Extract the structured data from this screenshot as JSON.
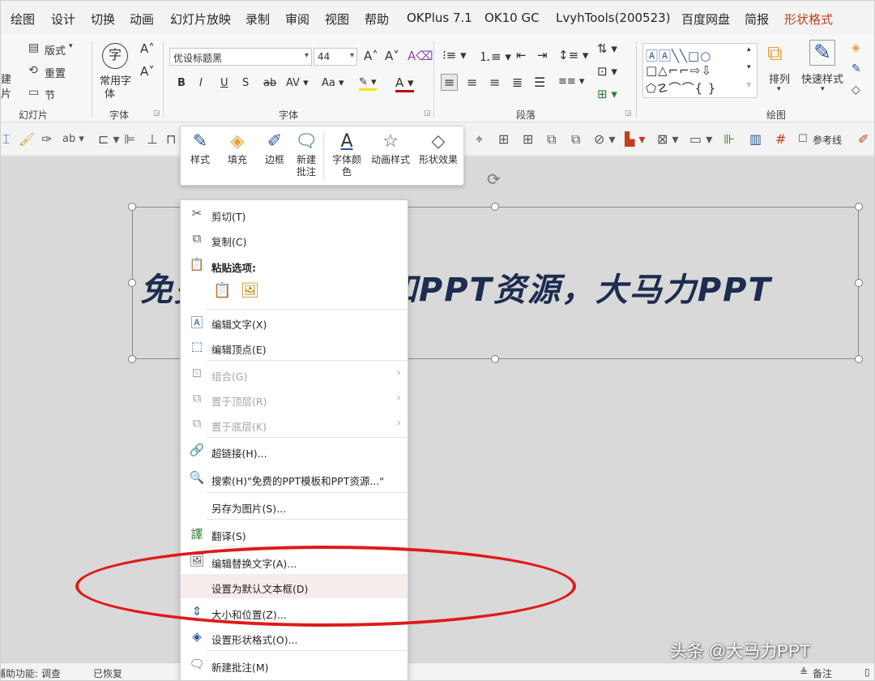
{
  "ribbon_tabs": [
    {
      "label": "绘图"
    },
    {
      "label": "设计"
    },
    {
      "label": "切换"
    },
    {
      "label": "动画"
    },
    {
      "label": "幻灯片放映"
    },
    {
      "label": "录制"
    },
    {
      "label": "审阅"
    },
    {
      "label": "视图"
    },
    {
      "label": "帮助"
    },
    {
      "label": "OKPlus 7.1"
    },
    {
      "label": "OK10 GC"
    },
    {
      "label": "LvyhTools(200523)"
    },
    {
      "label": "百度网盘"
    },
    {
      "label": "简报"
    },
    {
      "label": "形状格式",
      "active": true
    }
  ],
  "ribbon": {
    "slides_group": {
      "label": "幻灯片",
      "layout": "版式",
      "reset": "重置",
      "section": "节",
      "new_partial_1": "建",
      "new_partial_2": "片"
    },
    "fonts_group": {
      "label": "字体",
      "common_fonts_line1": "常用字",
      "common_fonts_line2": "体",
      "char_icon": "字"
    },
    "font_group": {
      "label": "字体",
      "font_name": "优设标题黑",
      "font_size": "44"
    },
    "paragraph_group": {
      "label": "段落"
    },
    "drawing_group": {
      "label": "绘图",
      "arrange": "排列",
      "quick_styles": "快速样式"
    }
  },
  "quick_toolbar": {
    "ref_line_label": "参考线"
  },
  "slide": {
    "title_text": "免费的PPT模板和PPT资源，大马力PPT"
  },
  "mini_toolbar": {
    "style": "样式",
    "fill": "填充",
    "border_line": "边框",
    "new_comment_line1": "新建",
    "new_comment_line2": "批注",
    "font_color_line1": "字体颜",
    "font_color_line2": "色",
    "animation_style": "动画样式",
    "shape_effect": "形状效果"
  },
  "context_menu": {
    "cut": "剪切(T)",
    "copy": "复制(C)",
    "paste_options": "粘贴选项:",
    "edit_text": "编辑文字(X)",
    "edit_points": "编辑顶点(E)",
    "group": "组合(G)",
    "bring_front": "置于顶层(R)",
    "send_back": "置于底层(K)",
    "hyperlink": "超链接(H)...",
    "search": "搜索(H)\"免费的PPT模板和PPT资源...\"",
    "save_as_picture": "另存为图片(S)...",
    "translate": "翻译(S)",
    "edit_alt_text": "编辑替换文字(A)...",
    "set_default_textbox": "设置为默认文本框(D)",
    "size_position": "大小和位置(Z)...",
    "format_shape": "设置形状格式(O)...",
    "new_comment": "新建批注(M)"
  },
  "status_bar": {
    "accessibility": "辅助功能: 调查",
    "restored": "已恢复",
    "notes": "备注"
  },
  "watermark": "头条 @大马力PPT",
  "colors": {
    "active_tab": "#c43e1c",
    "highlight_ellipse": "#e01a1a",
    "slide_text": "#1d2c4f",
    "canvas": "#d9d9d9"
  }
}
